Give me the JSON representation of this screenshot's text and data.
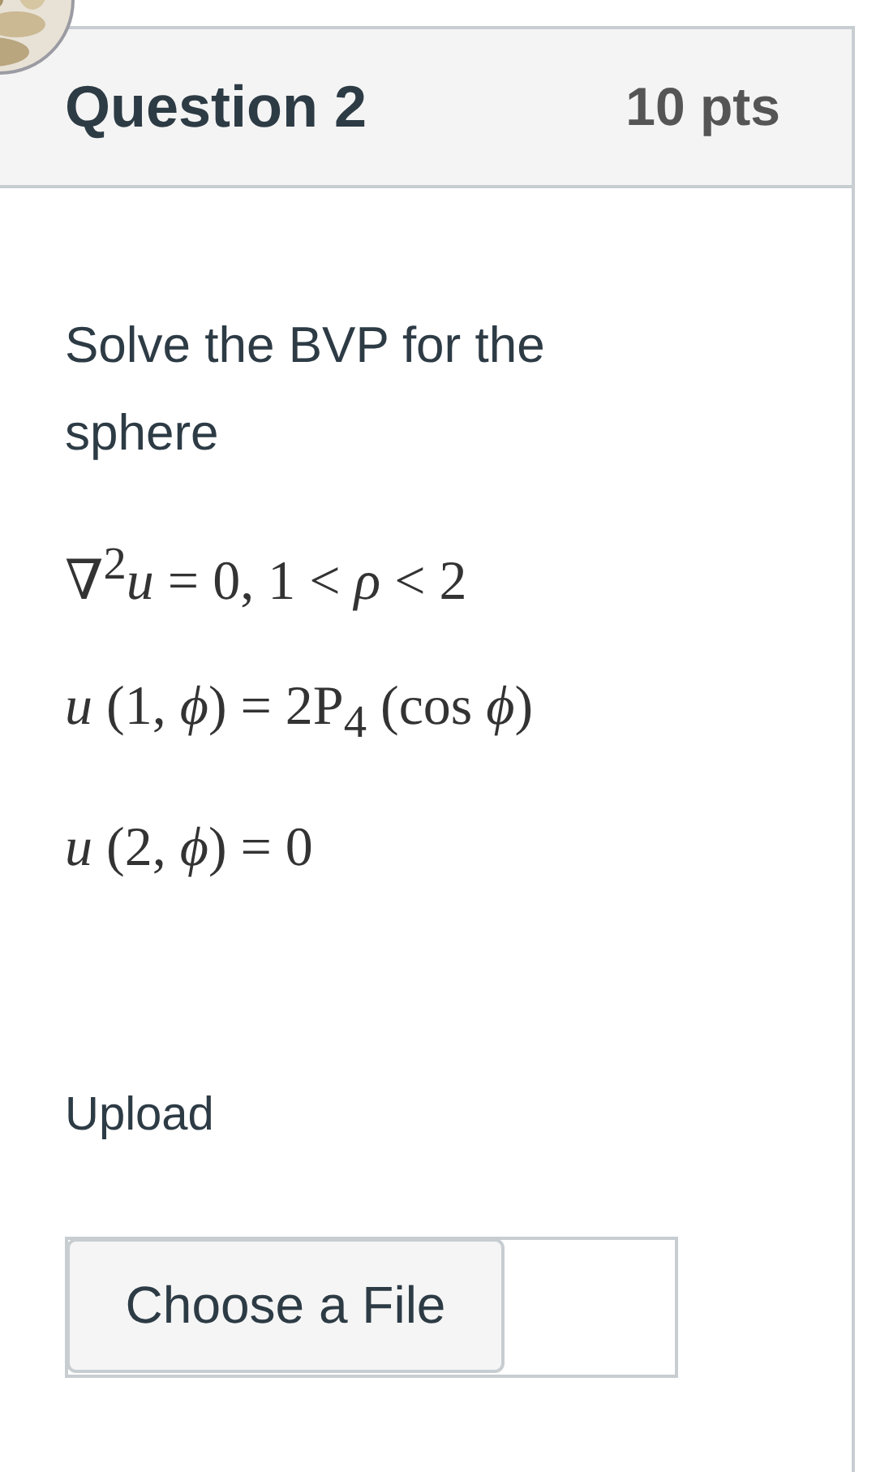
{
  "question": {
    "title": "Question 2",
    "points": "10 pts"
  },
  "prompt": "Solve the BVP  for the sphere",
  "equations": [
    "∇$^{2}$*u* = 0,  1 < *ρ* < 2",
    "*u* (1, *ϕ*) = 2P$_{4}$ (cos *ϕ*)",
    "*u* (2, *ϕ*) = 0"
  ],
  "upload": {
    "label": "Upload",
    "button": "Choose a File"
  }
}
